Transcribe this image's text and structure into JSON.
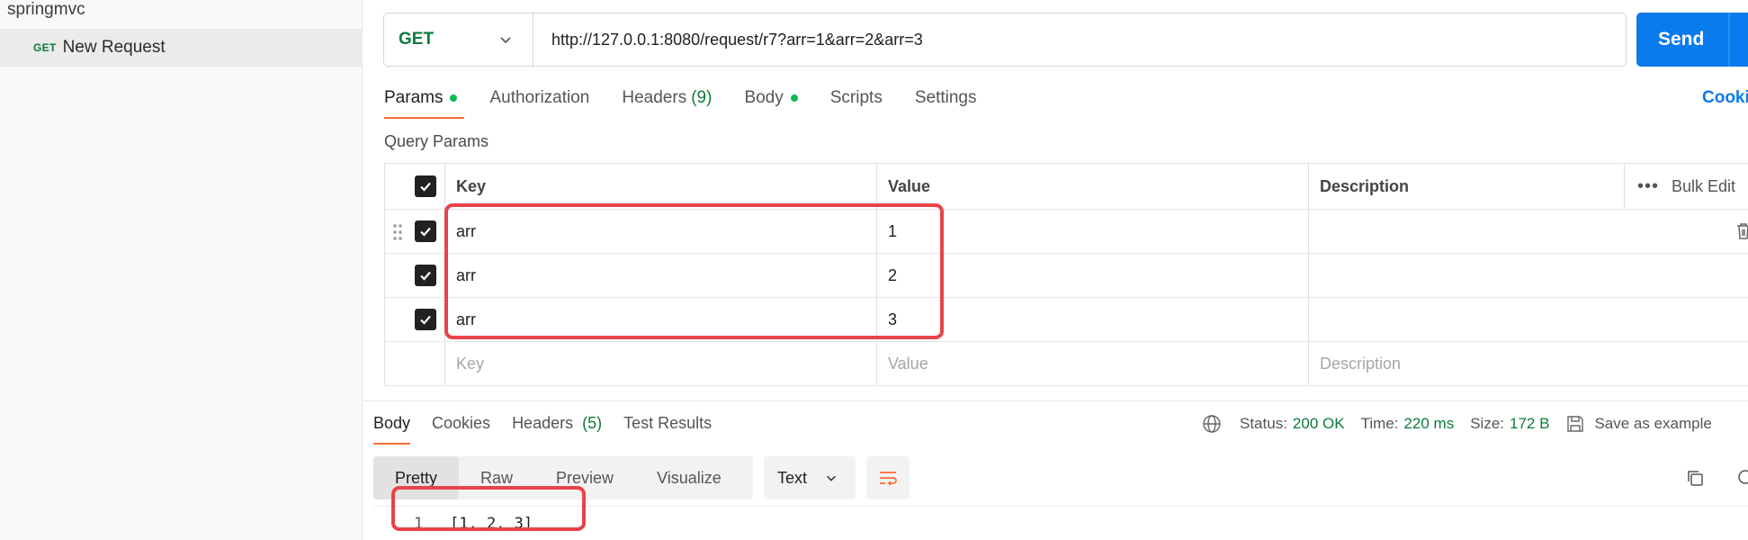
{
  "sidebar": {
    "collection_name": "springmvc",
    "request_method": "GET",
    "request_name": "New Request"
  },
  "request": {
    "method": "GET",
    "url": "http://127.0.0.1:8080/request/r7?arr=1&arr=2&arr=3",
    "send_label": "Send",
    "tabs": [
      {
        "label": "Params",
        "dot": true
      },
      {
        "label": "Authorization"
      },
      {
        "label": "Headers",
        "count": "(9)"
      },
      {
        "label": "Body",
        "dot": true
      },
      {
        "label": "Scripts"
      },
      {
        "label": "Settings"
      }
    ],
    "cookies_label": "Cookies"
  },
  "params": {
    "title": "Query Params",
    "headers": {
      "key": "Key",
      "value": "Value",
      "description": "Description",
      "bulk_edit": "Bulk Edit"
    },
    "rows": [
      {
        "key": "arr",
        "value": "1",
        "description": ""
      },
      {
        "key": "arr",
        "value": "2",
        "description": ""
      },
      {
        "key": "arr",
        "value": "3",
        "description": ""
      }
    ],
    "placeholders": {
      "key": "Key",
      "value": "Value",
      "description": "Description"
    }
  },
  "response": {
    "tabs": [
      {
        "label": "Body"
      },
      {
        "label": "Cookies"
      },
      {
        "label": "Headers",
        "count": "(5)"
      },
      {
        "label": "Test Results"
      }
    ],
    "status_label": "Status:",
    "status_value": "200 OK",
    "time_label": "Time:",
    "time_value": "220 ms",
    "size_label": "Size:",
    "size_value": "172 B",
    "save_label": "Save as example",
    "formats": [
      "Pretty",
      "Raw",
      "Preview",
      "Visualize"
    ],
    "text_type": "Text",
    "line_number": "1",
    "body": "[1, 2, 3]"
  },
  "colors": {
    "accent": "#ff6c37",
    "send": "#097bed",
    "get": "#0b7b3b",
    "highlight": "#e8434a"
  }
}
